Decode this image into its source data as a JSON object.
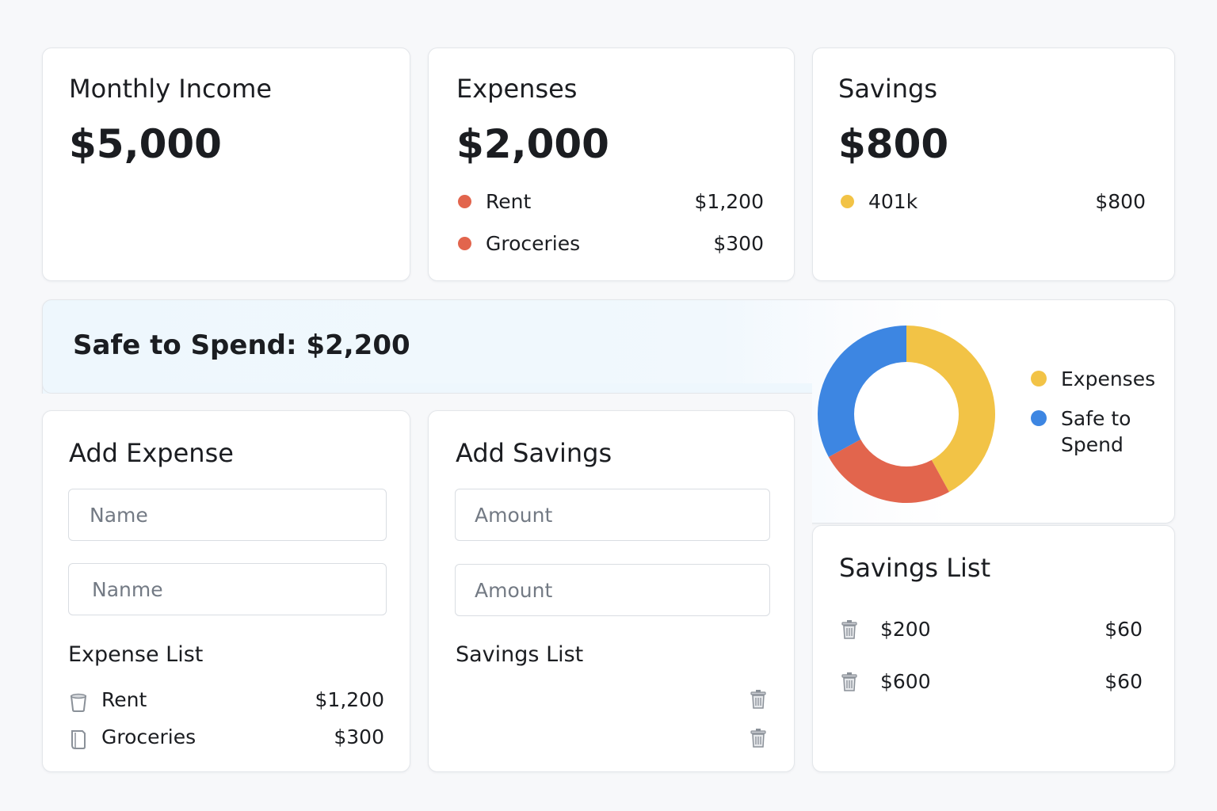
{
  "colors": {
    "expense_dot": "#e2654d",
    "savings_dot": "#f2c346",
    "chart_expenses": "#f2c346",
    "chart_safe": "#3d86e2",
    "chart_red": "#e2654d",
    "banner_bg": "#eef7fd"
  },
  "income": {
    "title": "Monthly Income",
    "value": "$5,000"
  },
  "expenses": {
    "title": "Expenses",
    "value": "$2,000",
    "items": [
      {
        "label": "Rent",
        "amount": "$1,200"
      },
      {
        "label": "Groceries",
        "amount": "$300"
      }
    ]
  },
  "savings": {
    "title": "Savings",
    "value": "$800",
    "items": [
      {
        "label": "401k",
        "amount": "$800"
      }
    ]
  },
  "safe_to_spend": {
    "text": "Safe to Spend: $2,200"
  },
  "chart_data": {
    "type": "pie",
    "categories": [
      "Expenses",
      "",
      "Safe to Spend"
    ],
    "values": [
      42,
      25,
      33
    ],
    "legend": [
      "Expenses",
      "Safe to Spend"
    ],
    "legend_placement": "right"
  },
  "add_expense": {
    "title": "Add Expense",
    "name_placeholder": "Name",
    "name2_placeholder": "Nanme",
    "list_title": "Expense List",
    "items": [
      {
        "label": "Rent",
        "amount": "$1,200",
        "icon": "trash-icon"
      },
      {
        "label": "Groceries",
        "amount": "$300",
        "icon": "trash-icon"
      }
    ]
  },
  "add_savings": {
    "title": "Add Savings",
    "amount_placeholder": "Amount",
    "amount2_placeholder": "Amount",
    "list_title": "Savings List"
  },
  "savings_list": {
    "title": "Savings List",
    "items": [
      {
        "label": "$200",
        "amount": "$60",
        "icon": "trash-icon"
      },
      {
        "label": "$600",
        "amount": "$60",
        "icon": "trash-icon"
      }
    ]
  }
}
